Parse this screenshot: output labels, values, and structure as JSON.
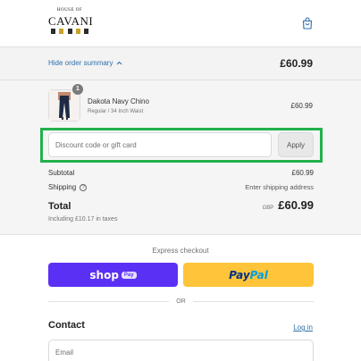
{
  "brand": {
    "small_text": "HOUSE OF",
    "name": "CAVANI",
    "stripe_colors": [
      "#2b2b2b",
      "#c9a227",
      "#2b2b2b",
      "#c9a227",
      "#2b2b2b"
    ]
  },
  "header": {
    "cart_icon": "shopping-bag-icon"
  },
  "summary_bar": {
    "toggle_label": "Hide order summary",
    "toggle_icon": "chevron-up-icon",
    "total": "£60.99"
  },
  "product": {
    "quantity": "1",
    "name": "Dakota Navy Chino",
    "variant": "Regular / 34 Inch Waist",
    "price": "£60.99"
  },
  "discount": {
    "placeholder": "Discount code or gift card",
    "apply_label": "Apply"
  },
  "totals": {
    "subtotal_label": "Subtotal",
    "subtotal_value": "£60.99",
    "shipping_label": "Shipping",
    "shipping_value": "Enter shipping address",
    "total_label": "Total",
    "currency": "GBP",
    "total_value": "£60.99",
    "taxes_note": "Including £10.17 in taxes"
  },
  "express": {
    "title": "Express checkout",
    "shop_label": "shop",
    "shop_pay_pill": "Pay",
    "paypal_pay": "Pay",
    "paypal_pal": "Pal",
    "or_text": "OR"
  },
  "contact": {
    "title": "Contact",
    "login_label": "Log in",
    "email_placeholder": "Email"
  },
  "colors": {
    "accent_link": "#2f6fab",
    "shop_pay": "#5a31f4",
    "paypal": "#ffc439",
    "highlight": "#22b14c"
  }
}
